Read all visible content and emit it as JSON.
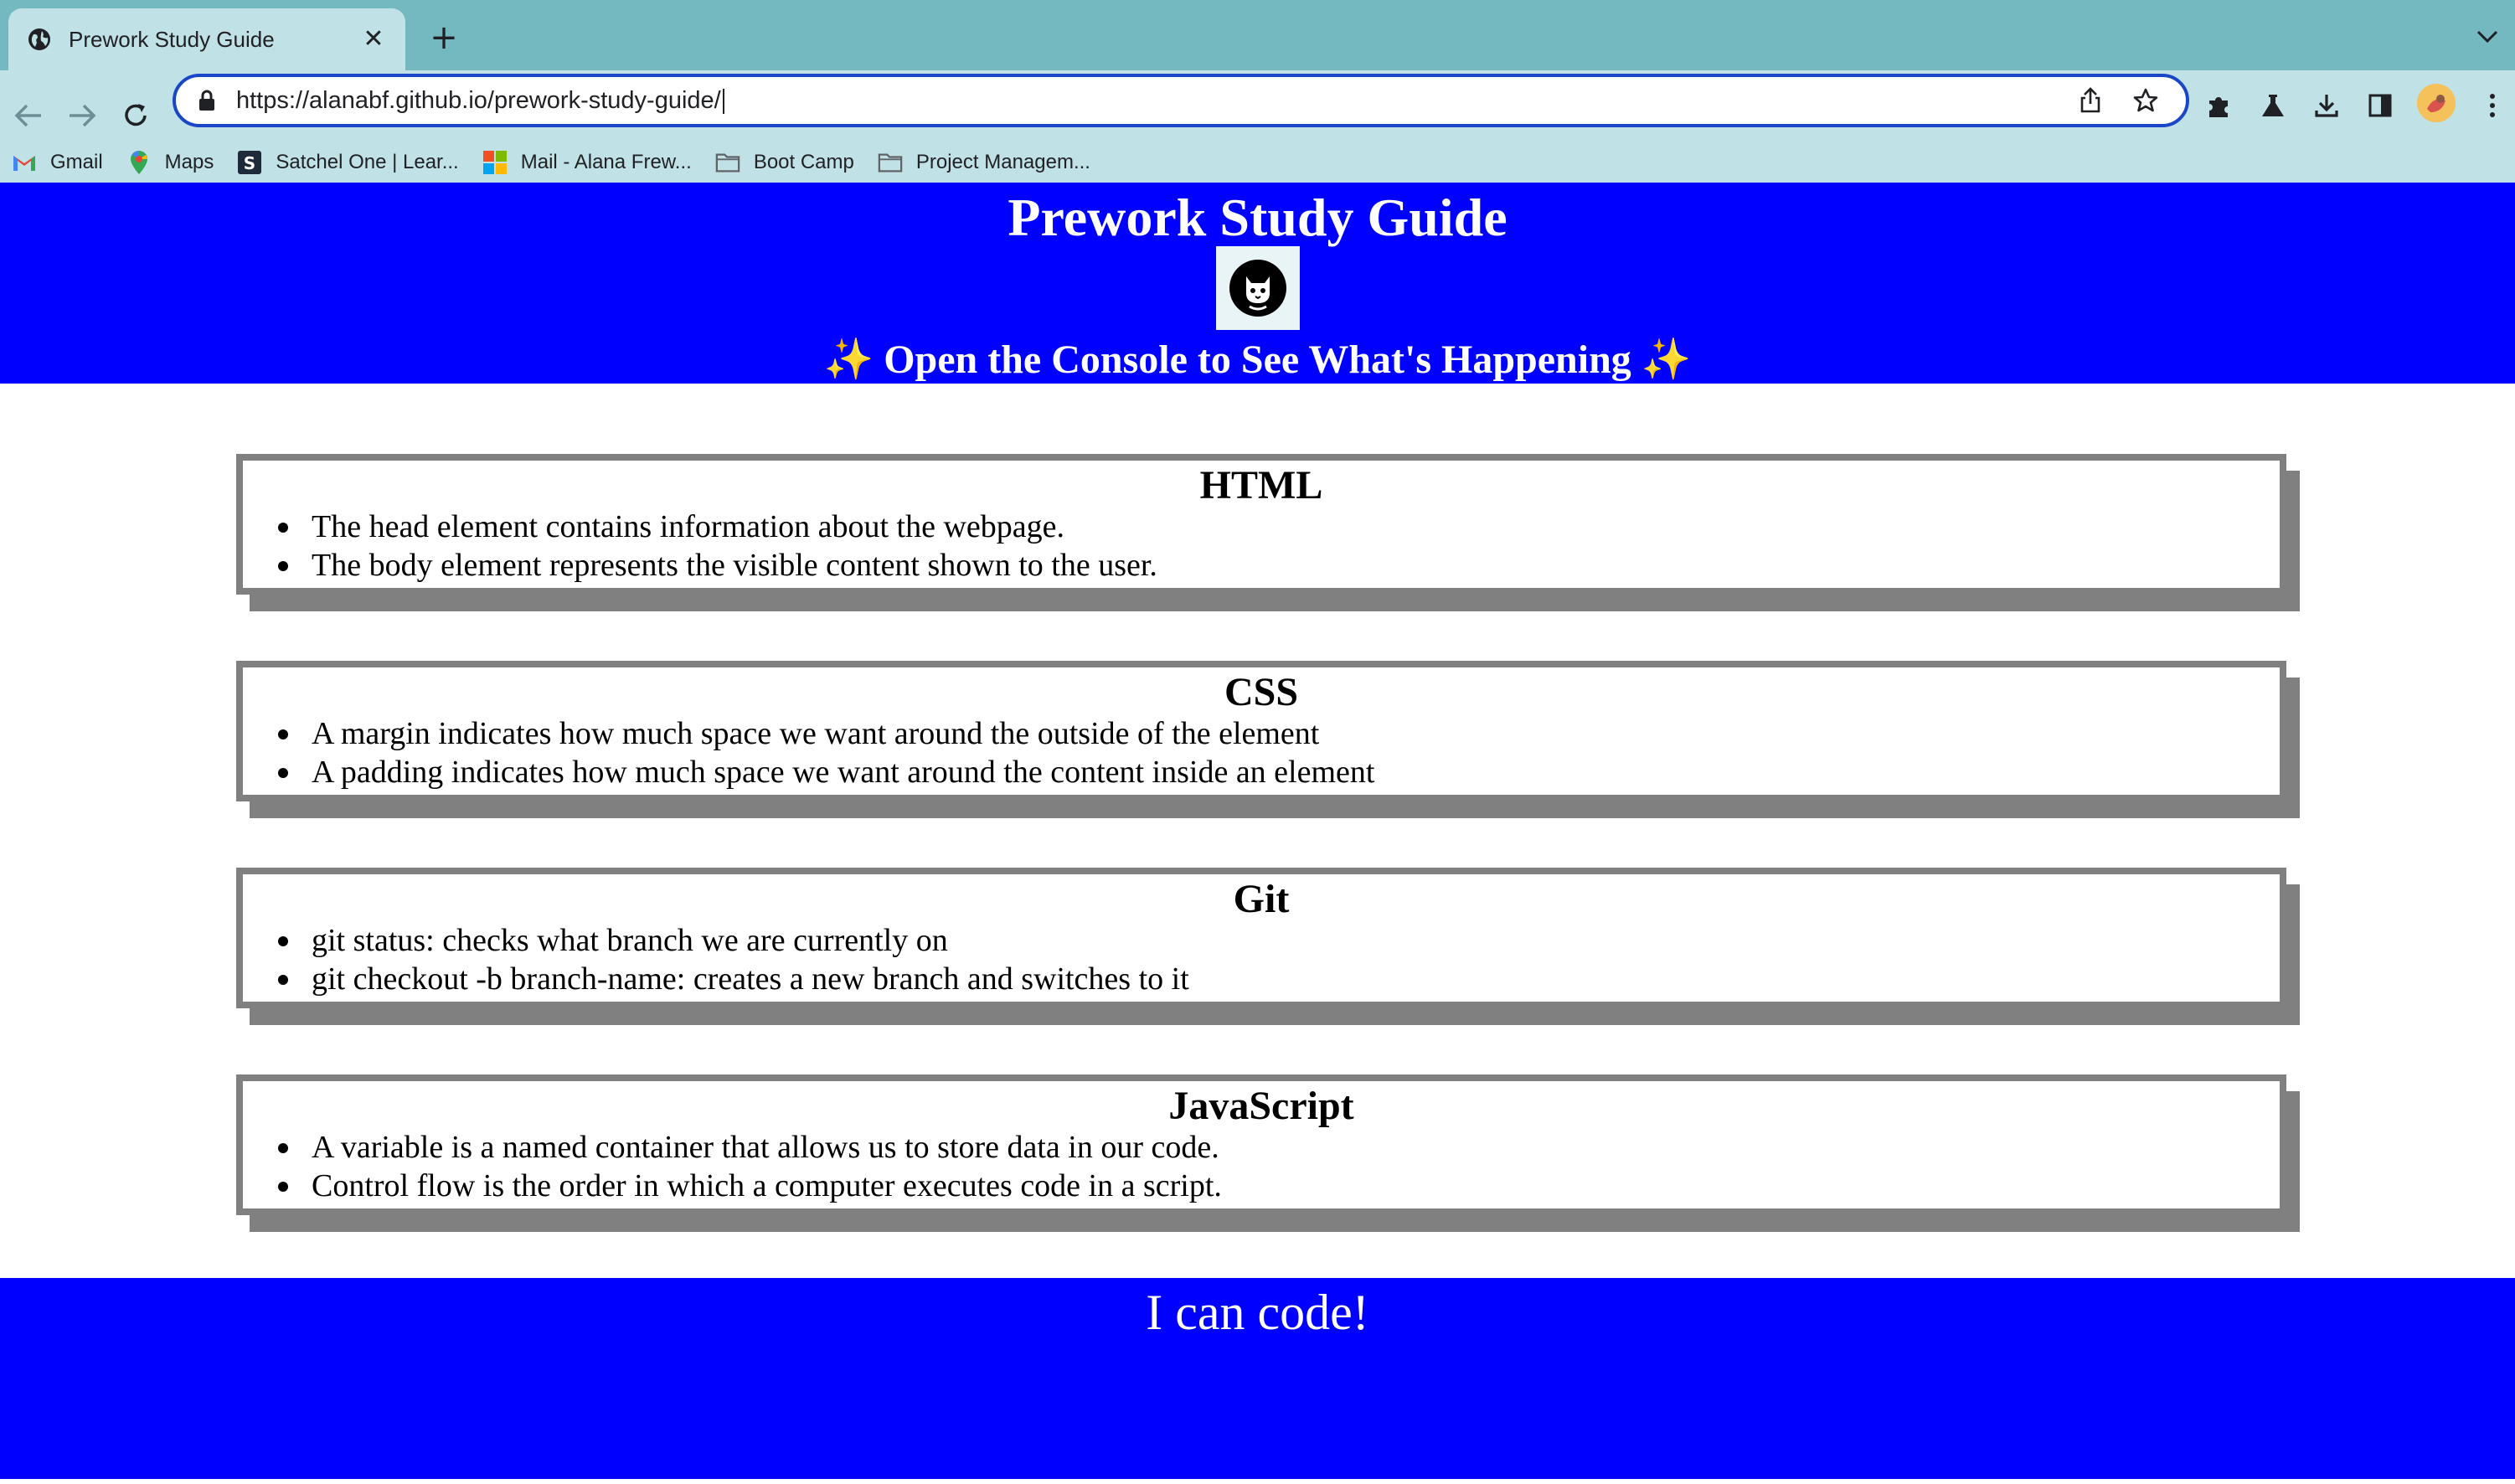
{
  "browser": {
    "tab_title": "Prework Study Guide",
    "url": "https://alanabf.github.io/prework-study-guide/",
    "bookmarks": [
      {
        "label": "Gmail",
        "icon": "gmail-icon"
      },
      {
        "label": "Maps",
        "icon": "maps-icon"
      },
      {
        "label": "Satchel One | Lear...",
        "icon": "satchel-icon"
      },
      {
        "label": "Mail - Alana Frew...",
        "icon": "microsoft-icon"
      },
      {
        "label": "Boot Camp",
        "icon": "folder-icon"
      },
      {
        "label": "Project Managem...",
        "icon": "folder-icon"
      }
    ],
    "accent_color": "#1a47c8",
    "frame_color": "#74b8c0",
    "toolbar_color": "#c0e1e6"
  },
  "header": {
    "title": "Prework Study Guide",
    "subtitle": "✨ Open the Console to See What's Happening ✨",
    "logo": "cat-logo-icon",
    "background": "#0000ff"
  },
  "sections": [
    {
      "heading": "HTML",
      "items": [
        "The head element contains information about the webpage.",
        "The body element represents the visible content shown to the user."
      ]
    },
    {
      "heading": "CSS",
      "items": [
        "A margin indicates how much space we want around the outside of the element",
        "A padding indicates how much space we want around the content inside an element"
      ]
    },
    {
      "heading": "Git",
      "items": [
        "git status: checks what branch we are currently on",
        "git checkout -b branch-name: creates a new branch and switches to it"
      ]
    },
    {
      "heading": "JavaScript",
      "items": [
        "A variable is a named container that allows us to store data in our code.",
        "Control flow is the order in which a computer executes code in a script."
      ]
    }
  ],
  "footer": {
    "text": "I can code!",
    "background": "#0000ff"
  }
}
